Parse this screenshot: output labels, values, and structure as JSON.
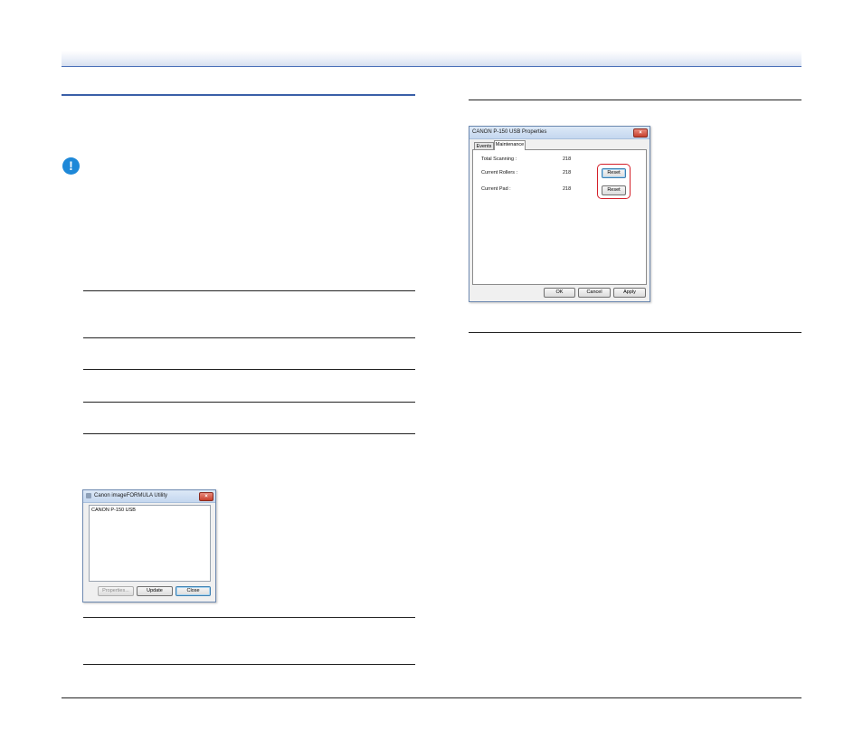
{
  "utility_dialog": {
    "title": "Canon imageFORMULA Utility",
    "device_item": "CANON P-150 USB",
    "buttons": {
      "properties": "Properties...",
      "update": "Update",
      "close": "Close"
    },
    "close_glyph": "×"
  },
  "properties_dialog": {
    "title": "CANON P-150 USB Properties",
    "tabs": [
      "Events",
      "Maintenance"
    ],
    "active_tab": "Maintenance",
    "fields": [
      {
        "label": "Total Scanning :",
        "value": "218"
      },
      {
        "label": "Current Rollers :",
        "value": "218"
      },
      {
        "label": "Current Pad :",
        "value": "218"
      }
    ],
    "reset_label": "Reset",
    "buttons": {
      "ok": "OK",
      "cancel": "Cancel",
      "apply": "Apply"
    },
    "close_glyph": "×"
  },
  "icons": {
    "notice": "exclamation-icon"
  },
  "colors": {
    "accent_rule": "#3a5fa8",
    "notice_icon": "#1e88d8",
    "highlight": "#d4202a"
  }
}
